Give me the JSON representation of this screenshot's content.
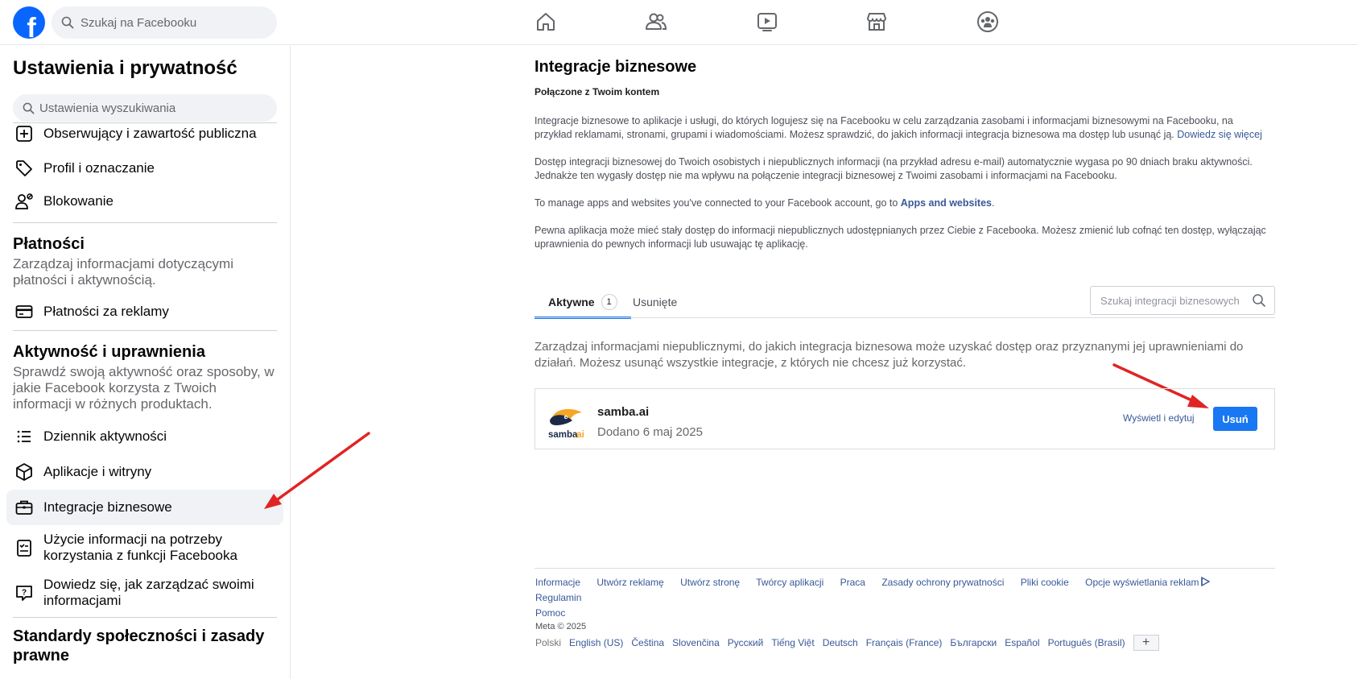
{
  "header": {
    "logo_letter": "f",
    "search_placeholder": "Szukaj na Facebooku",
    "nav_icons": [
      "home-icon",
      "friends-icon",
      "video-icon",
      "marketplace-icon",
      "groups-icon"
    ]
  },
  "sidebar": {
    "title": "Ustawienia i prywatność",
    "search_placeholder": "Ustawienia wyszukiwania",
    "items_top": [
      {
        "label": "Obserwujący i zawartość publiczna",
        "icon": "plus-box-icon"
      },
      {
        "label": "Profil i oznaczanie",
        "icon": "tag-icon"
      },
      {
        "label": "Blokowanie",
        "icon": "user-block-icon"
      }
    ],
    "payments": {
      "title": "Płatności",
      "desc": "Zarządzaj informacjami dotyczącymi płatności i aktywnością.",
      "item": "Płatności za reklamy"
    },
    "activity": {
      "title": "Aktywność i uprawnienia",
      "desc": "Sprawdź swoją aktywność oraz sposoby, w jakie Facebook korzysta z Twoich informacji w różnych produktach.",
      "items": [
        {
          "label": "Dziennik aktywności"
        },
        {
          "label": "Aplikacje i witryny"
        },
        {
          "label": "Integracje biznesowe"
        },
        {
          "label": "Użycie informacji na potrzeby korzystania z funkcji Facebooka"
        },
        {
          "label": "Dowiedz się, jak zarządzać swoimi informacjami"
        }
      ]
    },
    "standards": {
      "title": "Standardy społeczności i zasady prawne"
    }
  },
  "main": {
    "title": "Integracje biznesowe",
    "subtitle": "Połączone z Twoim kontem",
    "p1": "Integracje biznesowe to aplikacje i usługi, do których logujesz się na Facebooku w celu zarządzania zasobami i informacjami biznesowymi na Facebooku, na przykład reklamami, stronami, grupami i wiadomościami. Możesz sprawdzić, do jakich informacji integracja biznesowa ma dostęp lub usunąć ją.",
    "p1_link": "Dowiedz się więcej",
    "p2": "Dostęp integracji biznesowej do Twoich osobistych i niepublicznych informacji (na przykład adresu e-mail) automatycznie wygasa po 90 dniach braku aktywności. Jednakże ten wygasły dostęp nie ma wpływu na połączenie integracji biznesowej z Twoimi zasobami i informacjami na Facebooku.",
    "p3_prefix": "To manage apps and websites you've connected to your Facebook account, go to",
    "p3_link": "Apps and websites",
    "p3_suffix": ".",
    "p4": "Pewna aplikacja może mieć stały dostęp do informacji niepublicznych udostępnianych przez Ciebie z Facebooka. Możesz zmienić lub cofnąć ten dostęp, wyłączając uprawnienia do pewnych informacji lub usuwając tę aplikację.",
    "tabs": {
      "active_label": "Aktywne",
      "active_count": "1",
      "removed_label": "Usunięte"
    },
    "search_placeholder": "Szukaj integracji biznesowych",
    "manage_text": "Zarządzaj informacjami niepublicznymi, do jakich integracja biznesowa może uzyskać dostęp oraz przyznanymi jej uprawnieniami do działań. Możesz usunąć wszystkie integracje, z których nie chcesz już korzystać.",
    "integration": {
      "name": "samba.ai",
      "added": "Dodano 6 maj 2025",
      "logo_text": "samba",
      "logo_suffix": ".ai",
      "edit_label": "Wyświetl i edytuj",
      "remove_label": "Usuń"
    }
  },
  "footer": {
    "links": [
      "Informacje",
      "Utwórz reklamę",
      "Utwórz stronę",
      "Twórcy aplikacji",
      "Praca",
      "Zasady ochrony prywatności",
      "Pliki cookie",
      "Opcje wyświetlania reklam",
      "Regulamin",
      "Pomoc"
    ],
    "copyright": "Meta © 2025",
    "current_lang": "Polski",
    "langs": [
      "English (US)",
      "Čeština",
      "Slovenčina",
      "Русский",
      "Tiếng Việt",
      "Deutsch",
      "Français (France)",
      "Български",
      "Español",
      "Português (Brasil)"
    ],
    "plus": "+"
  },
  "colors": {
    "brand": "#0866ff",
    "button": "#1877f2",
    "link": "#385898",
    "arrow": "#e02424"
  }
}
